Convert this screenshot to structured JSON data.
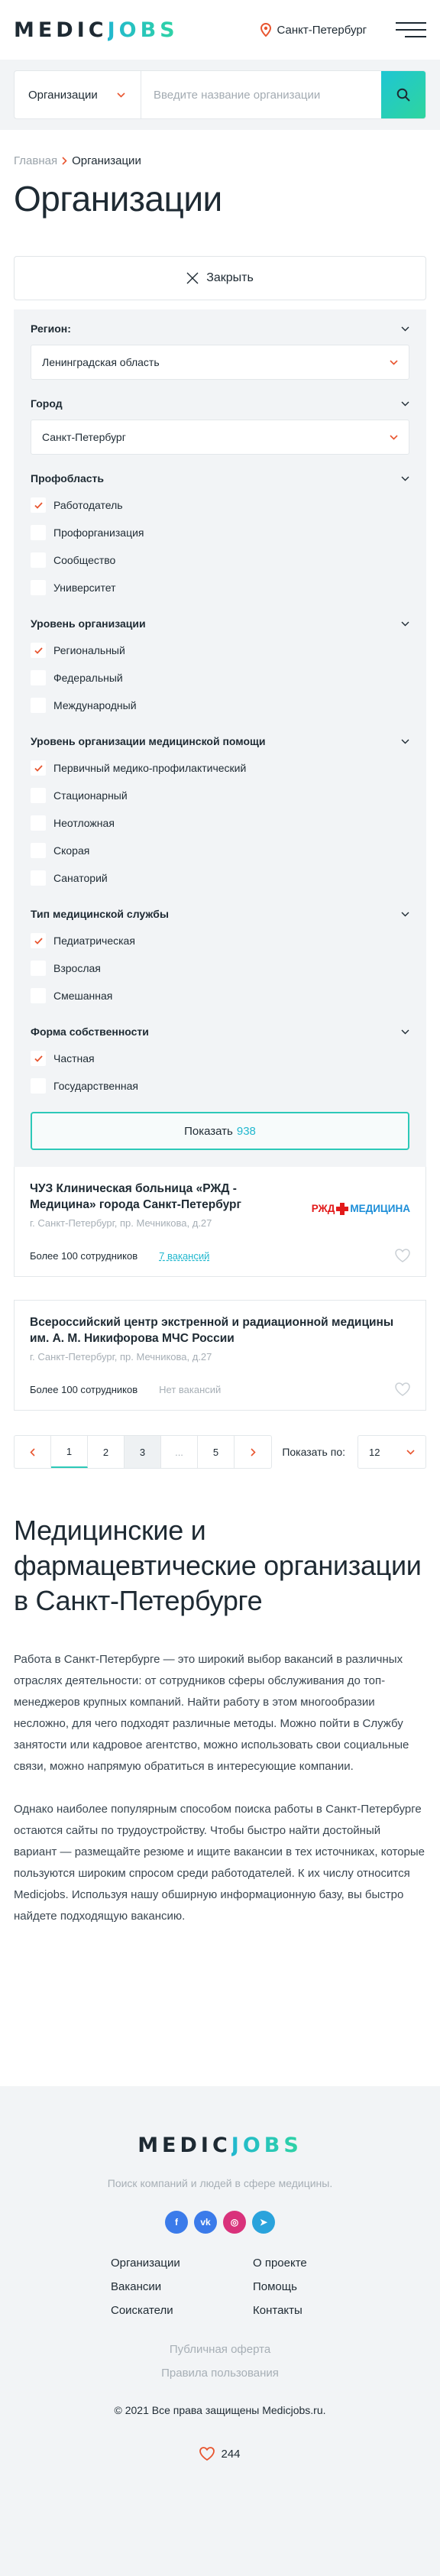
{
  "header": {
    "logo_part1": "MEDIC",
    "logo_part2": "JOBS",
    "city": "Санкт-Петербург",
    "brand_color": "#22b8cf",
    "accent_color": "#2fd59e"
  },
  "search": {
    "category": "Организации",
    "placeholder": "Введите название организации",
    "value": ""
  },
  "breadcrumbs": {
    "home": "Главная",
    "current": "Организации"
  },
  "page_title": "Организации",
  "close_label": "Закрыть",
  "filters": {
    "region": {
      "label": "Регион:",
      "value": "Ленинградская область"
    },
    "city": {
      "label": "Город",
      "value": "Санкт-Петербург"
    },
    "profile": {
      "label": "Профобласть",
      "options": [
        {
          "label": "Работодатель",
          "checked": true
        },
        {
          "label": "Профорганизация",
          "checked": false
        },
        {
          "label": "Сообщество",
          "checked": false
        },
        {
          "label": "Университет",
          "checked": false
        }
      ]
    },
    "level": {
      "label": "Уровень организации",
      "options": [
        {
          "label": "Региональный",
          "checked": true
        },
        {
          "label": "Федеральный",
          "checked": false
        },
        {
          "label": "Международный",
          "checked": false
        }
      ]
    },
    "care_level": {
      "label": "Уровень организации медицинской помощи",
      "options": [
        {
          "label": "Первичный медико-профилактический",
          "checked": true
        },
        {
          "label": "Стационарный",
          "checked": false
        },
        {
          "label": "Неотложная",
          "checked": false
        },
        {
          "label": "Скорая",
          "checked": false
        },
        {
          "label": "Санаторий",
          "checked": false
        }
      ]
    },
    "service_type": {
      "label": "Тип медицинской службы",
      "options": [
        {
          "label": "Педиатрическая",
          "checked": true
        },
        {
          "label": "Взрослая",
          "checked": false
        },
        {
          "label": "Смешанная",
          "checked": false
        }
      ]
    },
    "ownership": {
      "label": "Форма собственности",
      "options": [
        {
          "label": "Частная",
          "checked": true
        },
        {
          "label": "Государственная",
          "checked": false
        }
      ]
    },
    "show_label": "Показать",
    "show_count": "938"
  },
  "cards": [
    {
      "title": "ЧУЗ Клиническая больница «РЖД - Медицина» города Санкт-Петербург",
      "address": "г. Санкт-Петербург, пр. Мечникова, д.27",
      "employees": "Более 100 сотрудников",
      "vacancies": "7 вакансий",
      "logo_left": "РЖД",
      "logo_right": "МЕДИЦИНА"
    },
    {
      "title": "Всероссийский центр экстренной и радиационной медицины им. А. М. Никифорова МЧС России",
      "address": "г. Санкт-Петербург, пр. Мечникова, д.27",
      "employees": "Более 100 сотрудников",
      "vacancies": "Нет вакансий"
    }
  ],
  "pagination": {
    "pages": [
      "1",
      "2",
      "3",
      "...",
      "5"
    ],
    "current": "1",
    "per_page_label": "Показать по:",
    "per_page_value": "12"
  },
  "seo": {
    "title": "Медицинские и фармацевтические организации в Санкт-Петербурге",
    "p1": "Работа в Санкт-Петербурге — это широкий выбор вакансий в различных отраслях деятельности: от сотрудников сферы обслуживания до топ-менеджеров крупных компаний. Найти работу в этом многообразии несложно, для чего подходят различные методы. Можно пойти в Службу занятости или кадровое агентство, можно использовать свои социальные связи, можно напрямую обратиться в интересующие компании.",
    "p2": "Однако наиболее популярным способом поиска работы в Санкт-Петербурге остаются сайты по трудоустройству. Чтобы быстро найти достойный вариант — размещайте резюме и ищите вакансии в тех источниках, которые пользуются широким спросом среди работодателей. К их числу относится Medicjobs. Используя нашу обширную информационную базу, вы быстро найдете подходящую вакансию."
  },
  "footer": {
    "tagline": "Поиск компаний и людей в сфере медицины.",
    "socials": [
      {
        "name": "facebook-icon",
        "glyph": "f",
        "color": "#3b7bea"
      },
      {
        "name": "vk-icon",
        "glyph": "vk",
        "color": "#3b7bea"
      },
      {
        "name": "instagram-icon",
        "glyph": "◎",
        "color": "#d9327b"
      },
      {
        "name": "telegram-icon",
        "glyph": "➤",
        "color": "#2aa3dc"
      }
    ],
    "nav": [
      "Организации",
      "О проекте",
      "Вакансии",
      "Помощь",
      "Соискатели",
      "Контакты"
    ],
    "offer": "Публичная оферта",
    "rules": "Правила пользования",
    "copyright": "© 2021 Все права защищены Medicjobs.ru.",
    "likes": "244"
  }
}
